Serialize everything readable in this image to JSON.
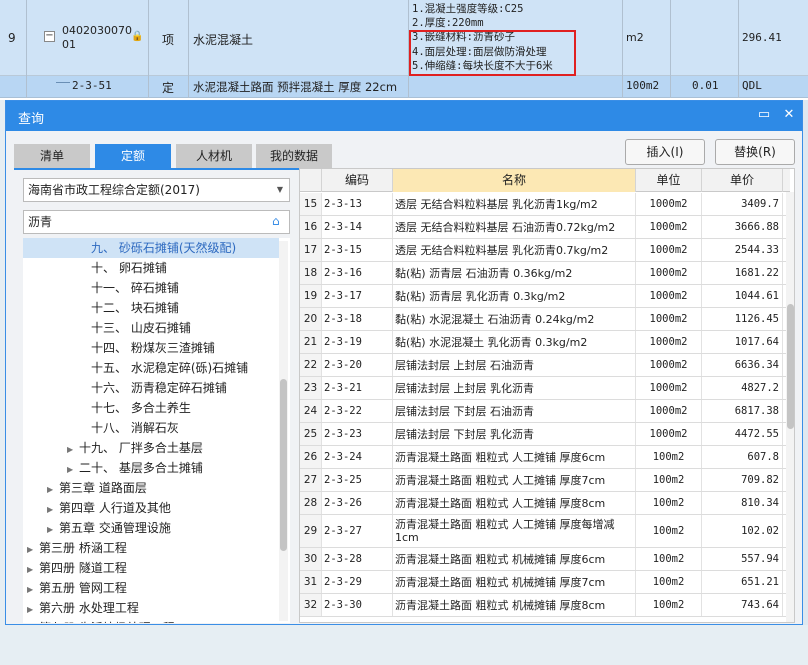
{
  "bg_table": {
    "row1": {
      "index": "9",
      "code_line1": "0402030070",
      "code_line2": "01",
      "type": "项",
      "name": "水泥混凝土",
      "desc_lines": [
        "1.混凝土强度等级:C25",
        "2.厚度:220mm",
        "3.嵌缝材料:沥青砂子",
        "4.面层处理:面层做防滑处理",
        "5.伸缩缝:每块长度不大于6米"
      ],
      "unit": "m2",
      "qty": "296.41"
    },
    "row2": {
      "code": "2-3-51",
      "type": "定",
      "name": "水泥混凝土路面 预拌混凝土 厚度 22cm",
      "unit": "100m2",
      "qty": "0.01",
      "extra": "QDL"
    }
  },
  "dialog": {
    "title": "查询",
    "tabs": [
      "清单",
      "定额",
      "人材机",
      "我的数据"
    ],
    "active_tab": 1,
    "insert_btn": "插入(I)",
    "replace_btn": "替换(R)",
    "library_select": "海南省市政工程综合定额(2017)",
    "search_value": "沥青"
  },
  "tree": [
    {
      "label": "九、 砂砾石摊铺(天然级配)",
      "indent": 56,
      "arrow": "",
      "selected": true
    },
    {
      "label": "十、 卵石摊铺",
      "indent": 56,
      "arrow": ""
    },
    {
      "label": "十一、 碎石摊铺",
      "indent": 56,
      "arrow": ""
    },
    {
      "label": "十二、 块石摊铺",
      "indent": 56,
      "arrow": ""
    },
    {
      "label": "十三、 山皮石摊铺",
      "indent": 56,
      "arrow": ""
    },
    {
      "label": "十四、 粉煤灰三渣摊铺",
      "indent": 56,
      "arrow": ""
    },
    {
      "label": "十五、 水泥稳定碎(砾)石摊铺",
      "indent": 56,
      "arrow": ""
    },
    {
      "label": "十六、 沥青稳定碎石摊铺",
      "indent": 56,
      "arrow": ""
    },
    {
      "label": "十七、 多合土养生",
      "indent": 56,
      "arrow": ""
    },
    {
      "label": "十八、 消解石灰",
      "indent": 56,
      "arrow": ""
    },
    {
      "label": "十九、 厂拌多合土基层",
      "indent": 44,
      "arrow": "▶"
    },
    {
      "label": "二十、 基层多合土摊铺",
      "indent": 44,
      "arrow": "▶"
    },
    {
      "label": "第三章 道路面层",
      "indent": 24,
      "arrow": "▶"
    },
    {
      "label": "第四章 人行道及其他",
      "indent": 24,
      "arrow": "▶"
    },
    {
      "label": "第五章 交通管理设施",
      "indent": 24,
      "arrow": "▶"
    },
    {
      "label": "第三册 桥涵工程",
      "indent": 4,
      "arrow": "▶"
    },
    {
      "label": "第四册 隧道工程",
      "indent": 4,
      "arrow": "▶"
    },
    {
      "label": "第五册 管网工程",
      "indent": 4,
      "arrow": "▶"
    },
    {
      "label": "第六册 水处理工程",
      "indent": 4,
      "arrow": "▶"
    },
    {
      "label": "第七册 生活垃圾处理工程",
      "indent": 4,
      "arrow": "▶"
    }
  ],
  "grid": {
    "headers": [
      "编码",
      "名称",
      "单位",
      "单价"
    ],
    "rows": [
      {
        "no": "15",
        "code": "2-3-13",
        "name": "透层 无结合料粒料基层 乳化沥青1kg/m2",
        "unit": "1000m2",
        "price": "3409.7",
        "h": 23
      },
      {
        "no": "16",
        "code": "2-3-14",
        "name": "透层 无结合料粒料基层 石油沥青0.72kg/m2",
        "unit": "1000m2",
        "price": "3666.88",
        "h": 23
      },
      {
        "no": "17",
        "code": "2-3-15",
        "name": "透层 无结合料粒料基层 乳化沥青0.7kg/m2",
        "unit": "1000m2",
        "price": "2544.33",
        "h": 23
      },
      {
        "no": "18",
        "code": "2-3-16",
        "name": "黏(粘) 沥青层 石油沥青 0.36kg/m2",
        "unit": "1000m2",
        "price": "1681.22",
        "h": 23
      },
      {
        "no": "19",
        "code": "2-3-17",
        "name": "黏(粘) 沥青层 乳化沥青 0.3kg/m2",
        "unit": "1000m2",
        "price": "1044.61",
        "h": 23
      },
      {
        "no": "20",
        "code": "2-3-18",
        "name": "黏(粘) 水泥混凝土 石油沥青 0.24kg/m2",
        "unit": "1000m2",
        "price": "1126.45",
        "h": 23
      },
      {
        "no": "21",
        "code": "2-3-19",
        "name": "黏(粘) 水泥混凝土 乳化沥青 0.3kg/m2",
        "unit": "1000m2",
        "price": "1017.64",
        "h": 23
      },
      {
        "no": "22",
        "code": "2-3-20",
        "name": "层铺法封层 上封层 石油沥青",
        "unit": "1000m2",
        "price": "6636.34",
        "h": 23
      },
      {
        "no": "23",
        "code": "2-3-21",
        "name": "层铺法封层 上封层 乳化沥青",
        "unit": "1000m2",
        "price": "4827.2",
        "h": 23
      },
      {
        "no": "24",
        "code": "2-3-22",
        "name": "层铺法封层 下封层 石油沥青",
        "unit": "1000m2",
        "price": "6817.38",
        "h": 23
      },
      {
        "no": "25",
        "code": "2-3-23",
        "name": "层铺法封层 下封层 乳化沥青",
        "unit": "1000m2",
        "price": "4472.55",
        "h": 23
      },
      {
        "no": "26",
        "code": "2-3-24",
        "name": "沥青混凝土路面 粗粒式 人工摊铺 厚度6cm",
        "unit": "100m2",
        "price": "607.8",
        "h": 23
      },
      {
        "no": "27",
        "code": "2-3-25",
        "name": "沥青混凝土路面 粗粒式 人工摊铺 厚度7cm",
        "unit": "100m2",
        "price": "709.82",
        "h": 23
      },
      {
        "no": "28",
        "code": "2-3-26",
        "name": "沥青混凝土路面 粗粒式 人工摊铺 厚度8cm",
        "unit": "100m2",
        "price": "810.34",
        "h": 23
      },
      {
        "no": "29",
        "code": "2-3-27",
        "name": "沥青混凝土路面 粗粒式 人工摊铺 厚度每增减1cm",
        "unit": "100m2",
        "price": "102.02",
        "h": 33
      },
      {
        "no": "30",
        "code": "2-3-28",
        "name": "沥青混凝土路面 粗粒式 机械摊铺 厚度6cm",
        "unit": "100m2",
        "price": "557.94",
        "h": 23
      },
      {
        "no": "31",
        "code": "2-3-29",
        "name": "沥青混凝土路面 粗粒式 机械摊铺 厚度7cm",
        "unit": "100m2",
        "price": "651.21",
        "h": 23
      },
      {
        "no": "32",
        "code": "2-3-30",
        "name": "沥青混凝土路面 粗粒式 机械摊铺 厚度8cm",
        "unit": "100m2",
        "price": "743.64",
        "h": 23
      }
    ]
  },
  "colors": {
    "accent": "#2e8ae6",
    "highlight_header": "#fce8b4",
    "selected_row": "#cfe3f6",
    "red_box": "#e02020"
  }
}
